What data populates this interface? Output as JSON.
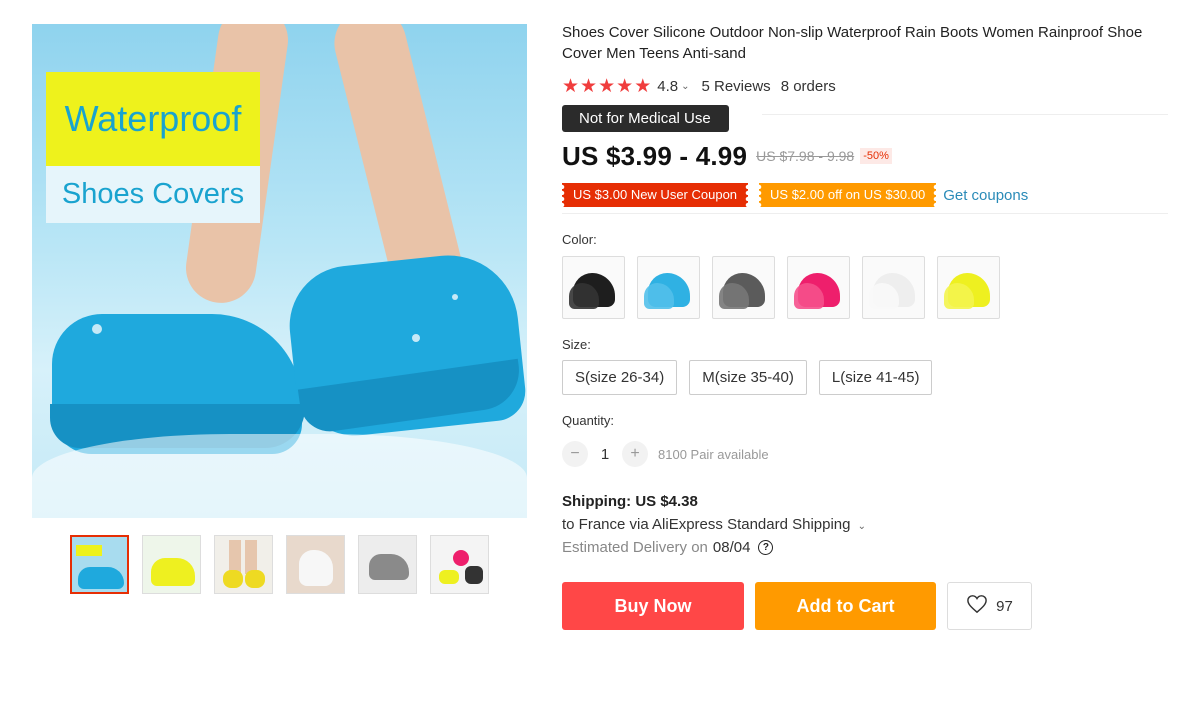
{
  "gallery": {
    "main_image": {
      "overlay_line1": "Waterproof",
      "overlay_line2": "Shoes Covers"
    },
    "thumbnails": [
      "thumb-blue",
      "thumb-yellow",
      "thumb-model",
      "thumb-white",
      "thumb-gray",
      "thumb-lifestyle"
    ],
    "active_index": 0
  },
  "product": {
    "title": "Shoes Cover Silicone Outdoor Non-slip Waterproof Rain Boots Women Rainproof Shoe Cover Men Teens Anti-sand",
    "rating": "4.8",
    "reviews": "5 Reviews",
    "orders": "8 orders",
    "badge": "Not for Medical Use"
  },
  "price": {
    "current": "US $3.99 - 4.99",
    "original": "US $7.98 - 9.98",
    "discount": "-50%"
  },
  "coupons": {
    "new_user": "US $3.00 New User Coupon",
    "off": "US $2.00 off on US $30.00",
    "get_coupons": "Get coupons"
  },
  "color": {
    "label": "Color:",
    "options": [
      {
        "name": "black",
        "hex": "#1e1e1e"
      },
      {
        "name": "blue",
        "hex": "#2fb1e3"
      },
      {
        "name": "gray",
        "hex": "#5b5b5b"
      },
      {
        "name": "pink",
        "hex": "#ee1f6c"
      },
      {
        "name": "white",
        "hex": "#eeeeee"
      },
      {
        "name": "yellow",
        "hex": "#eef020"
      }
    ]
  },
  "size": {
    "label": "Size:",
    "options": [
      "S(size 26-34)",
      "M(size 35-40)",
      "L(size 41-45)"
    ]
  },
  "quantity": {
    "label": "Quantity:",
    "minus": "−",
    "value": "1",
    "plus": "+",
    "available": "8100 Pair available"
  },
  "shipping": {
    "title": "Shipping: US $4.38",
    "method": "to France via AliExpress Standard Shipping",
    "estimated_label": "Estimated Delivery on",
    "date": "08/04",
    "help_icon": "?"
  },
  "actions": {
    "buy_now": "Buy Now",
    "add_to_cart": "Add to Cart",
    "wishlist_count": "97"
  },
  "colors": {
    "accent_red": "#ff4747",
    "accent_orange": "#ff9a00",
    "coupon_red": "#e62e04",
    "link_blue": "#2a8bb8",
    "star_red": "#f03d3d"
  }
}
